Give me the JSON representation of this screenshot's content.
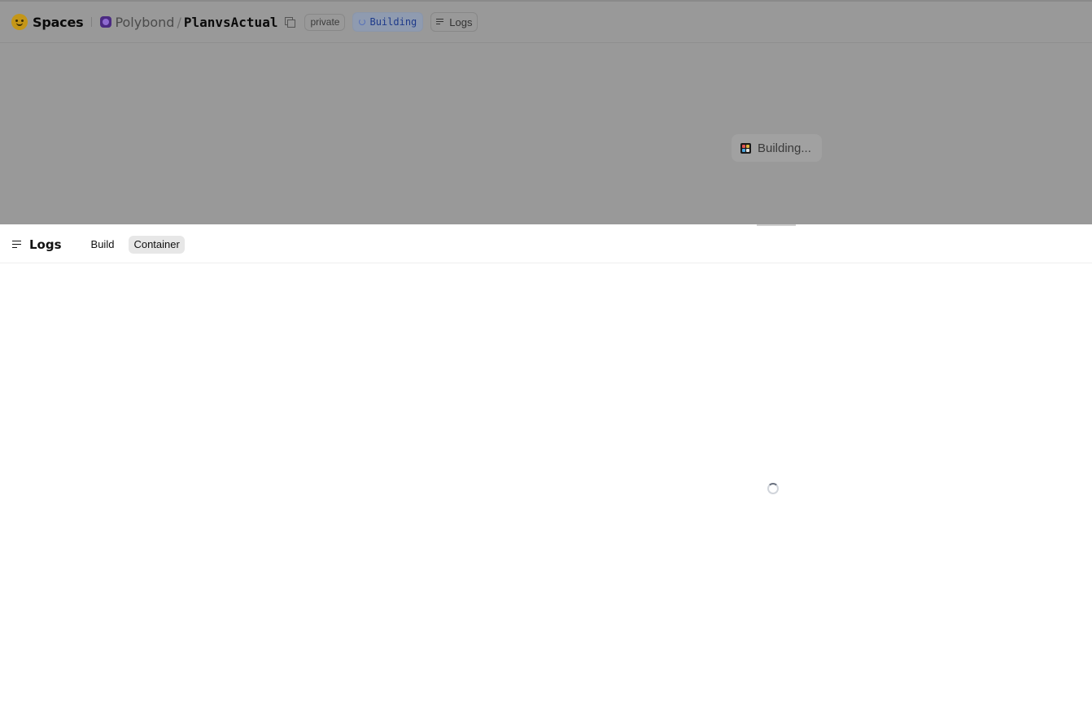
{
  "header": {
    "brand": "Spaces",
    "owner": "Polybond",
    "separator": "/",
    "space_name": "PlanvsActual",
    "visibility_badge": "private",
    "status_badge": "Building",
    "logs_button": "Logs"
  },
  "preview": {
    "status_text": "Building..."
  },
  "logs_panel": {
    "title": "Logs",
    "tabs": [
      {
        "label": "Build",
        "active": false
      },
      {
        "label": "Container",
        "active": true
      }
    ]
  },
  "icons": {
    "brand": "huggingface-logo-icon",
    "owner": "owner-avatar-icon",
    "copy": "copy-icon",
    "status": "spinner-icon",
    "logs": "logs-icon",
    "preview": "app-grid-icon",
    "loader": "loading-spinner-icon"
  },
  "colors": {
    "overlay": "#999999",
    "status_badge_text": "#1e3a8a",
    "active_tab_bg": "#e7e7e7"
  }
}
